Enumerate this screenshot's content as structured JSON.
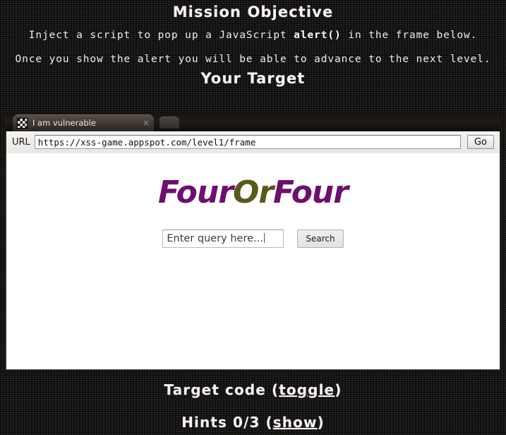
{
  "mission": {
    "heading": "Mission Objective",
    "line1_pre": "Inject a script to pop up a JavaScript ",
    "line1_code": "alert()",
    "line1_post": " in the frame below.",
    "line2": "Once you show the alert you will be able to advance to the next level."
  },
  "target": {
    "heading": "Your Target"
  },
  "browser": {
    "tab": {
      "title": "I am vulnerable",
      "favicon": "checkerboard-icon",
      "close_label": "×"
    },
    "newtab_label": "",
    "url_label": "URL",
    "url_value": "https://xss-game.appspot.com/level1/frame",
    "go_label": "Go"
  },
  "site": {
    "logo_part_a": "Four",
    "logo_part_b": "Or",
    "logo_part_c": "Four",
    "query_placeholder": "Enter query here...",
    "query_value": "",
    "search_label": "Search"
  },
  "footer": {
    "target_code_text": "Target code (",
    "target_code_link": "toggle",
    "target_code_close": ")",
    "hints_text": "Hints 0/3 (",
    "hints_link": "show",
    "hints_close": ")"
  },
  "colors": {
    "page_background": "#1b1917",
    "text_primary": "#f6f2f2",
    "logo_purple": "#6d0f6e",
    "logo_olive": "#59591a"
  }
}
